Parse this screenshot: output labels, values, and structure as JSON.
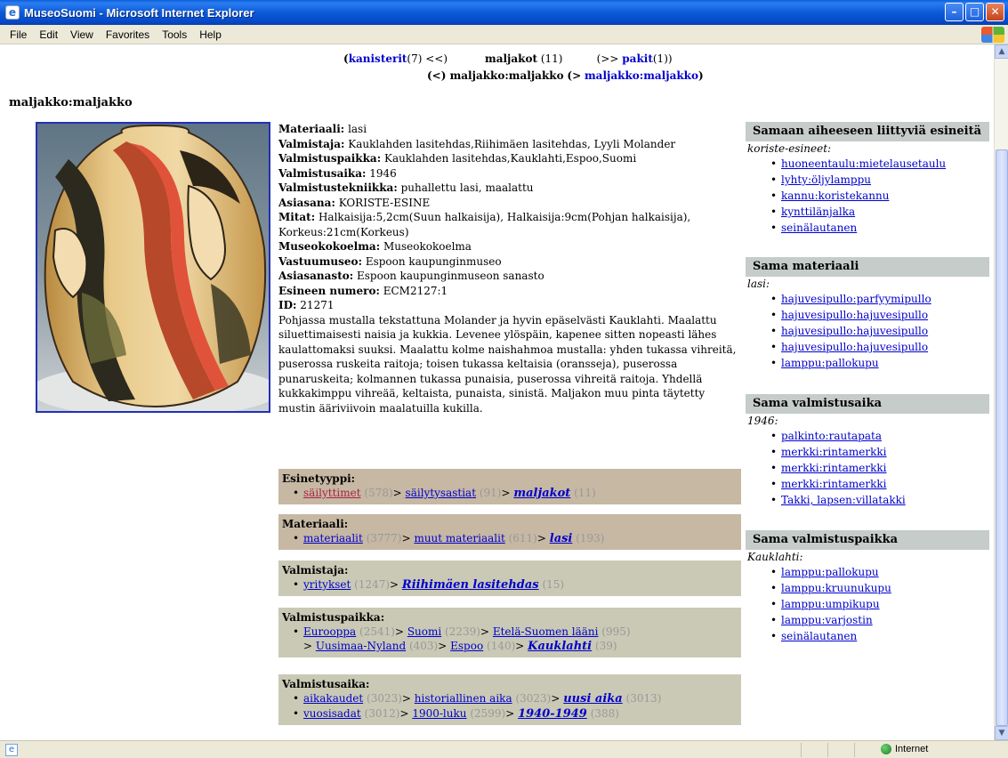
{
  "window": {
    "title": "MuseoSuomi - Microsoft Internet Explorer"
  },
  "menu": [
    {
      "label": "File",
      "key": "F"
    },
    {
      "label": "Edit",
      "key": "E"
    },
    {
      "label": "View",
      "key": "V"
    },
    {
      "label": "Favorites",
      "key": "a"
    },
    {
      "label": "Tools",
      "key": "T"
    },
    {
      "label": "Help",
      "key": "H"
    }
  ],
  "nav": {
    "prev_label": "kanisterit",
    "prev_count": "(7)",
    "prev_arrow": "<<)",
    "current_label": "maljakot",
    "current_count": "(11)",
    "next_arrow": "(>>",
    "next_label": "pakit",
    "next_count": "(1))",
    "item_prev": "(<) maljakko:maljakko",
    "item_next_prefix": "(>",
    "item_next_label": "maljakko:maljakko",
    "item_next_suffix": ")"
  },
  "page_title": "maljakko:maljakko",
  "details": [
    {
      "label": "Materiaali",
      "value": "lasi"
    },
    {
      "label": "Valmistaja",
      "value": "Kauklahden lasitehdas,Riihimäen lasitehdas, Lyyli Molander"
    },
    {
      "label": "Valmistuspaikka",
      "value": "Kauklahden lasitehdas,Kauklahti,Espoo,Suomi"
    },
    {
      "label": "Valmistusaika",
      "value": "1946"
    },
    {
      "label": "Valmistustekniikka",
      "value": "puhallettu lasi, maalattu"
    },
    {
      "label": "Asiasana",
      "value": "KORISTE-ESINE"
    },
    {
      "label": "Mitat",
      "value": "Halkaisija:5,2cm(Suun halkaisija), Halkaisija:9cm(Pohjan halkaisija), Korkeus:21cm(Korkeus)"
    },
    {
      "label": "Museokokoelma",
      "value": "Museokokoelma"
    },
    {
      "label": "Vastuumuseo",
      "value": "Espoon kaupunginmuseo"
    },
    {
      "label": "Asiasanasto",
      "value": "Espoon kaupunginmuseon sanasto"
    },
    {
      "label": "Esineen numero",
      "value": "ECM2127:1"
    },
    {
      "label": "ID",
      "value": "21271"
    }
  ],
  "description": "Pohjassa mustalla tekstattuna Molander ja hyvin epäselvästi Kauklahti. Maalattu siluettimaisesti naisia ja kukkia. Levenee ylöspäin, kapenee sitten nopeasti lähes kaulattomaksi suuksi. Maalattu kolme naishahmoa mustalla: yhden tukassa vihreitä, puserossa ruskeita raitoja; toisen tukassa keltaisia (oransseja), puserossa punaruskeita; kolmannen tukassa punaisia, puserossa vihreitä raitoja. Yhdellä kukkakimppu vihreää, keltaista, punaista, sinistä. Maljakon muu pinta täytetty mustin ääriviivoin maalatuilla kukilla.",
  "categories": {
    "esinetyyppi": {
      "heading": "Esinetyyppi:",
      "l1": "säilyttimet",
      "c1": "(578)",
      "l2": "säilytysastiat",
      "c2": "(91)",
      "l3": "maljakot",
      "c3": "(11)"
    },
    "materiaali": {
      "heading": "Materiaali:",
      "l1": "materiaalit",
      "c1": "(3777)",
      "l2": "muut materiaalit",
      "c2": "(611)",
      "l3": "lasi",
      "c3": "(193)"
    },
    "valmistaja": {
      "heading": "Valmistaja:",
      "l1": "yritykset",
      "c1": "(1247)",
      "l2": "Riihimäen lasitehdas",
      "c2": "(15)"
    },
    "valmistuspaikka": {
      "heading": "Valmistuspaikka:",
      "l1": "Eurooppa",
      "c1": "(2541)",
      "l2": "Suomi",
      "c2": "(2239)",
      "l3": "Etelä-Suomen lääni",
      "c3": "(995)",
      "l4": "Uusimaa-Nyland",
      "c4": "(403)",
      "l5": "Espoo",
      "c5": "(140)",
      "l6": "Kauklahti",
      "c6": "(39)"
    },
    "valmistusaika": {
      "heading": "Valmistusaika:",
      "a1": "aikakaudet",
      "ac1": "(3023)",
      "a2": "historiallinen aika",
      "ac2": "(3023)",
      "a3": "uusi aika",
      "ac3": "(3013)",
      "b1": "vuosisadat",
      "bc1": "(3012)",
      "b2": "1900-luku",
      "bc2": "(2599)",
      "b3": "1940-1949",
      "bc3": "(388)"
    }
  },
  "sidebar": {
    "box1": {
      "heading": "Samaan aiheeseen liittyviä esineitä",
      "sub": "koriste-esineet:",
      "items": [
        "huoneentaulu:mietelausetaulu",
        "lyhty:öljylamppu",
        "kannu:koristekannu",
        "kynttilänjalka",
        "seinälautanen"
      ]
    },
    "box2": {
      "heading": "Sama materiaali",
      "sub": "lasi:",
      "items": [
        "hajuvesipullo:parfyymipullo",
        "hajuvesipullo:hajuvesipullo",
        "hajuvesipullo:hajuvesipullo",
        "hajuvesipullo:hajuvesipullo",
        "lamppu:pallokupu"
      ]
    },
    "box3": {
      "heading": "Sama valmistusaika",
      "sub": "1946:",
      "items": [
        "palkinto:rautapata",
        "merkki:rintamerkki",
        "merkki:rintamerkki",
        "merkki:rintamerkki",
        "Takki, lapsen:villatakki"
      ]
    },
    "box4": {
      "heading": "Sama valmistuspaikka",
      "sub": "Kauklahti:",
      "items": [
        "lamppu:pallokupu",
        "lamppu:kruunukupu",
        "lamppu:umpikupu",
        "lamppu:varjostin",
        "seinälautanen"
      ]
    }
  },
  "status": {
    "zone": "Internet"
  },
  "icons": {
    "app": "ie-icon",
    "page": "page-icon",
    "zone": "globe-icon"
  }
}
